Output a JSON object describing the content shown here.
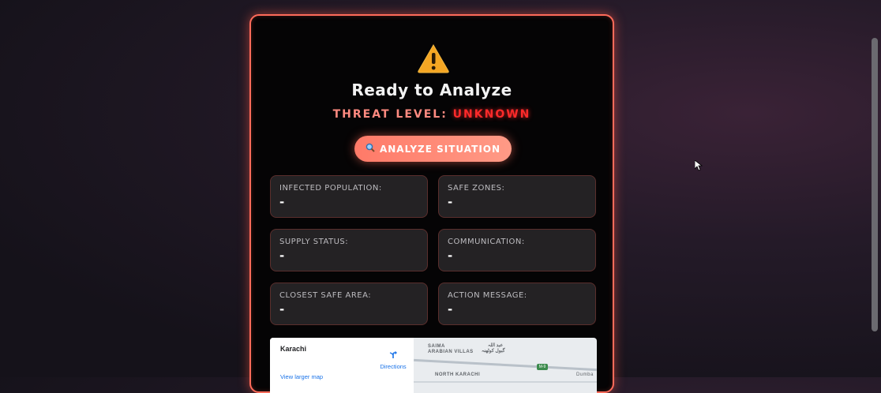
{
  "header": {
    "icon": "warning-icon",
    "title": "Ready to Analyze",
    "threat_label": "THREAT LEVEL:",
    "threat_value": "UNKNOWN"
  },
  "actions": {
    "analyze_icon": "search-icon",
    "analyze_label": "ANALYZE SITUATION"
  },
  "stats": [
    {
      "label": "INFECTED POPULATION:",
      "value": "-"
    },
    {
      "label": "SAFE ZONES:",
      "value": "-"
    },
    {
      "label": "SUPPLY STATUS:",
      "value": "-"
    },
    {
      "label": "COMMUNICATION:",
      "value": "-"
    },
    {
      "label": "CLOSEST SAFE AREA:",
      "value": "-"
    },
    {
      "label": "ACTION MESSAGE:",
      "value": "-"
    }
  ],
  "map": {
    "place_name": "Karachi",
    "directions_label": "Directions",
    "larger_map_link": "View larger map",
    "labels": {
      "saima": "SAIMA",
      "arabian_villas": "ARABIAN VILLAS",
      "north_karachi": "NORTH KARACHI",
      "urdu_label": "گبول کوٹھنہ",
      "urdu_label2": "عبد اللہ",
      "road_badge": "M-9",
      "edge_label": "Dumba"
    }
  },
  "colors": {
    "accent": "#ff6b5a",
    "threat_value": "#ff2a2a",
    "card_bg": "#050405",
    "tile_bg": "#242224"
  }
}
